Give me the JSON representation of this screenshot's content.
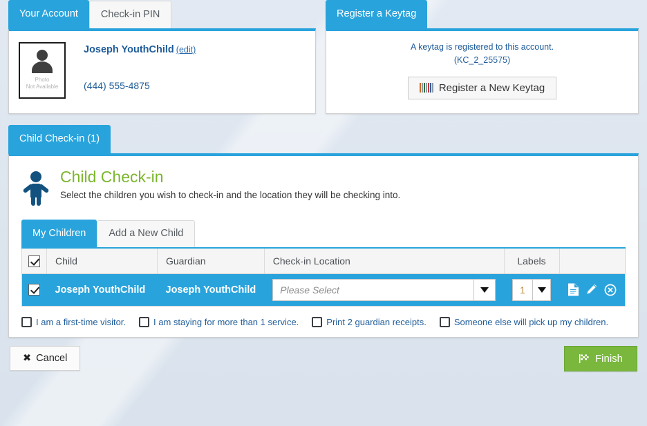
{
  "account_panel": {
    "tabs": [
      {
        "label": "Your Account",
        "active": true
      },
      {
        "label": "Check-in PIN",
        "active": false
      }
    ],
    "photo_caption_line1": "Photo",
    "photo_caption_line2": "Not Available",
    "name": "Joseph YouthChild",
    "edit_label": "(edit)",
    "phone": "(444) 555-4875"
  },
  "keytag_panel": {
    "tab_label": "Register a Keytag",
    "note_line1": "A keytag is registered to this account.",
    "note_line2": "(KC_2_25575)",
    "register_button": "Register a New Keytag",
    "register_button_icon": "barcode-icon"
  },
  "checkin_panel": {
    "tab_label": "Child Check-in (1)",
    "heading": "Child Check-in",
    "heading_icon": "child-icon",
    "subheading": "Select the children you wish to check-in and the location they will be checking into.",
    "inner_tabs": [
      {
        "label": "My Children",
        "active": true
      },
      {
        "label": "Add a New Child",
        "active": false
      }
    ],
    "table": {
      "headers": [
        "",
        "Child",
        "Guardian",
        "Check-in Location",
        "Labels",
        ""
      ],
      "header_select_all_checked": true,
      "rows": [
        {
          "selected": true,
          "child": "Joseph YouthChild",
          "guardian": "Joseph YouthChild",
          "location_value": "",
          "location_placeholder": "Please Select",
          "labels_count": "1",
          "actions": [
            "document-icon",
            "edit-pencil-icon",
            "remove-circle-icon"
          ]
        }
      ]
    },
    "options": [
      {
        "label": "I am a first-time visitor.",
        "checked": false
      },
      {
        "label": "I am staying for more than 1 service.",
        "checked": false
      },
      {
        "label": "Print 2 guardian receipts.",
        "checked": false
      },
      {
        "label": "Someone else will pick up my children.",
        "checked": false
      }
    ]
  },
  "footer": {
    "cancel_label": "Cancel",
    "cancel_icon": "x-icon",
    "finish_label": "Finish",
    "finish_icon": "checkered-flag-icon"
  },
  "colors": {
    "accent_blue": "#29a3dc",
    "green": "#7cb62e",
    "finish_green": "#79b83d",
    "link_blue": "#1f5c99",
    "navy": "#13527f"
  }
}
